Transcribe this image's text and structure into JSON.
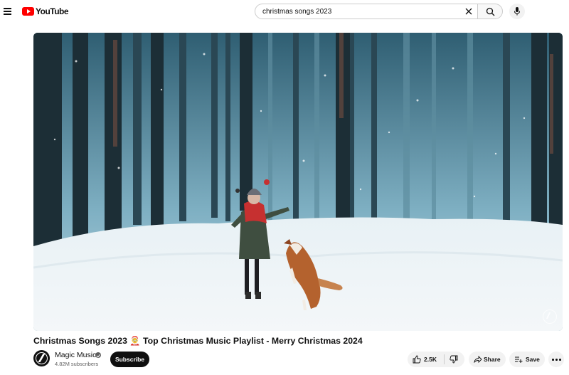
{
  "header": {
    "logo_text": "YouTube",
    "search": {
      "value": "christmas songs 2023",
      "placeholder": "Search"
    }
  },
  "video": {
    "title": "Christmas Songs 2023 🤶 Top Christmas Music Playlist - Merry Christmas 2024"
  },
  "channel": {
    "name": "Magic Music",
    "subscribers": "4.82M subscribers",
    "subscribe_label": "Subscribe"
  },
  "actions": {
    "likes": "2.5K",
    "share_label": "Share",
    "save_label": "Save"
  },
  "colors": {
    "brand_red": "#ff0000",
    "subscribe_bg": "#0f0f0f",
    "pill_bg": "#f2f2f2"
  },
  "icons": [
    "menu-icon",
    "youtube-logo-icon",
    "clear-icon",
    "search-icon",
    "mic-icon",
    "miniplayer-icon",
    "verified-icon",
    "thumbs-up-icon",
    "thumbs-down-icon",
    "share-icon",
    "save-playlist-icon",
    "more-icon"
  ]
}
